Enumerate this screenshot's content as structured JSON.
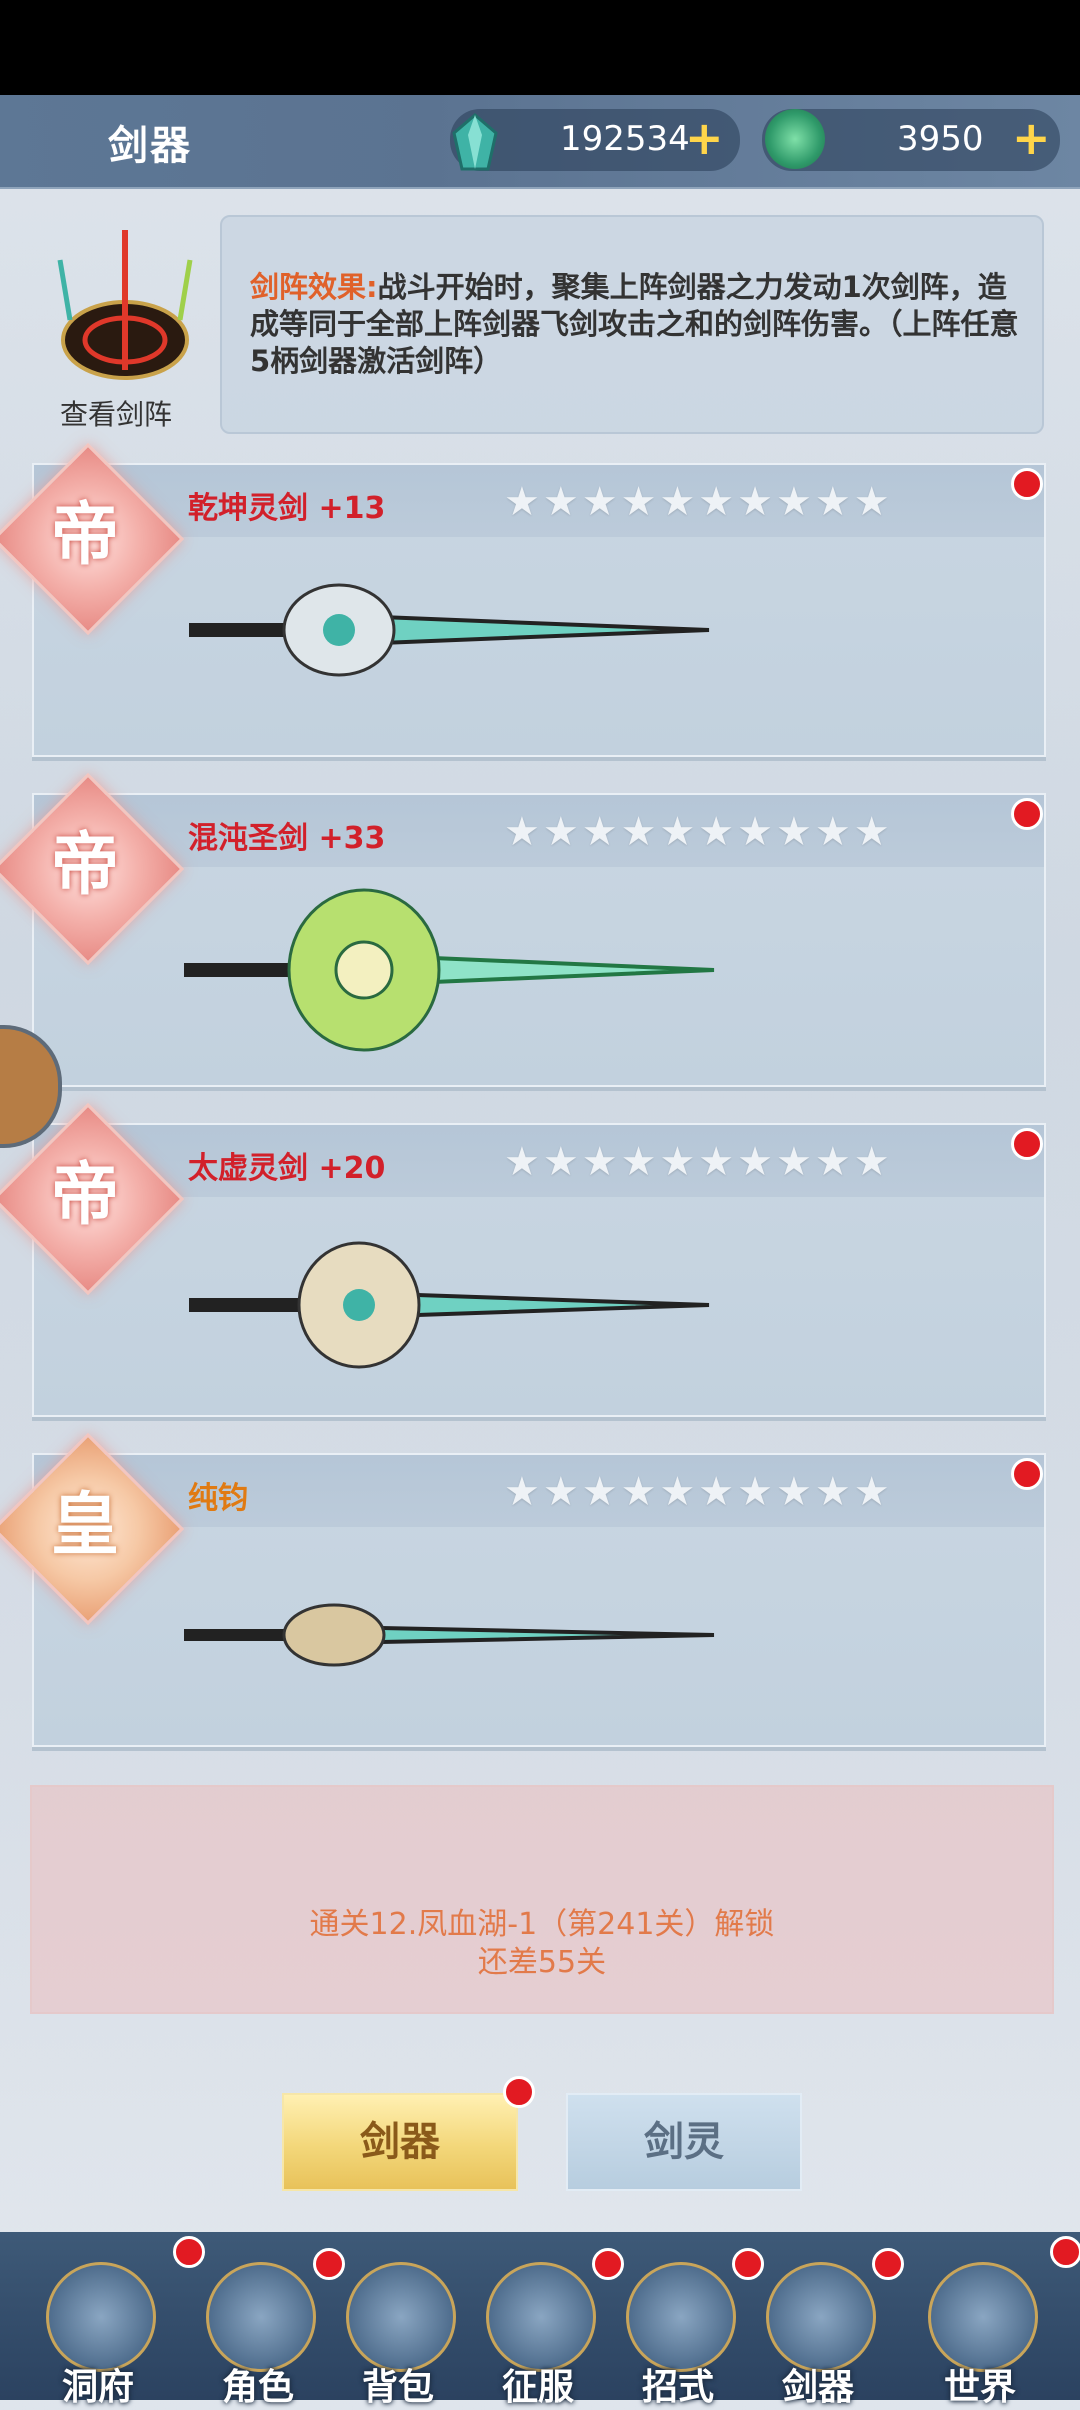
{
  "header": {
    "title": "剑器",
    "gems": "192534",
    "jade": "3950",
    "plus": "+"
  },
  "formation": {
    "label": "查看剑阵",
    "effect_key": "剑阵效果:",
    "effect_text": "战斗开始时，聚集上阵剑器之力发动1次剑阵，造成等同于全部上阵剑器飞剑攻击之和的剑阵伤害。（上阵任意5柄剑器激活剑阵）"
  },
  "swords": [
    {
      "rank": "帝",
      "name": "乾坤灵剑  +13",
      "stars": "★★★★★★★★★★",
      "colors": {
        "blade": "#6fd1c2",
        "guard": "#dfe6ea"
      }
    },
    {
      "rank": "帝",
      "name": "混沌圣剑  +33",
      "stars": "★★★★★★★★★★",
      "colors": {
        "blade": "#8fe3c8",
        "guard": "#b7e06f"
      }
    },
    {
      "rank": "帝",
      "name": "太虚灵剑  +20",
      "stars": "★★★★★★★★★★",
      "colors": {
        "blade": "#6fd1c2",
        "guard": "#e7dcc0"
      }
    },
    {
      "rank": "皇",
      "name": "纯钧",
      "stars": "★★★★★★★★★★",
      "colors": {
        "blade": "#6fd1c2",
        "guard": "#d9c7a0"
      }
    }
  ],
  "locked": {
    "line1": "通关12.凤血湖-1（第241关）解锁",
    "line2": "还差55关"
  },
  "tabs": {
    "active": "剑器",
    "inactive": "剑灵"
  },
  "nav": [
    "洞府",
    "角色",
    "背包",
    "征服",
    "招式",
    "剑器",
    "世界"
  ]
}
